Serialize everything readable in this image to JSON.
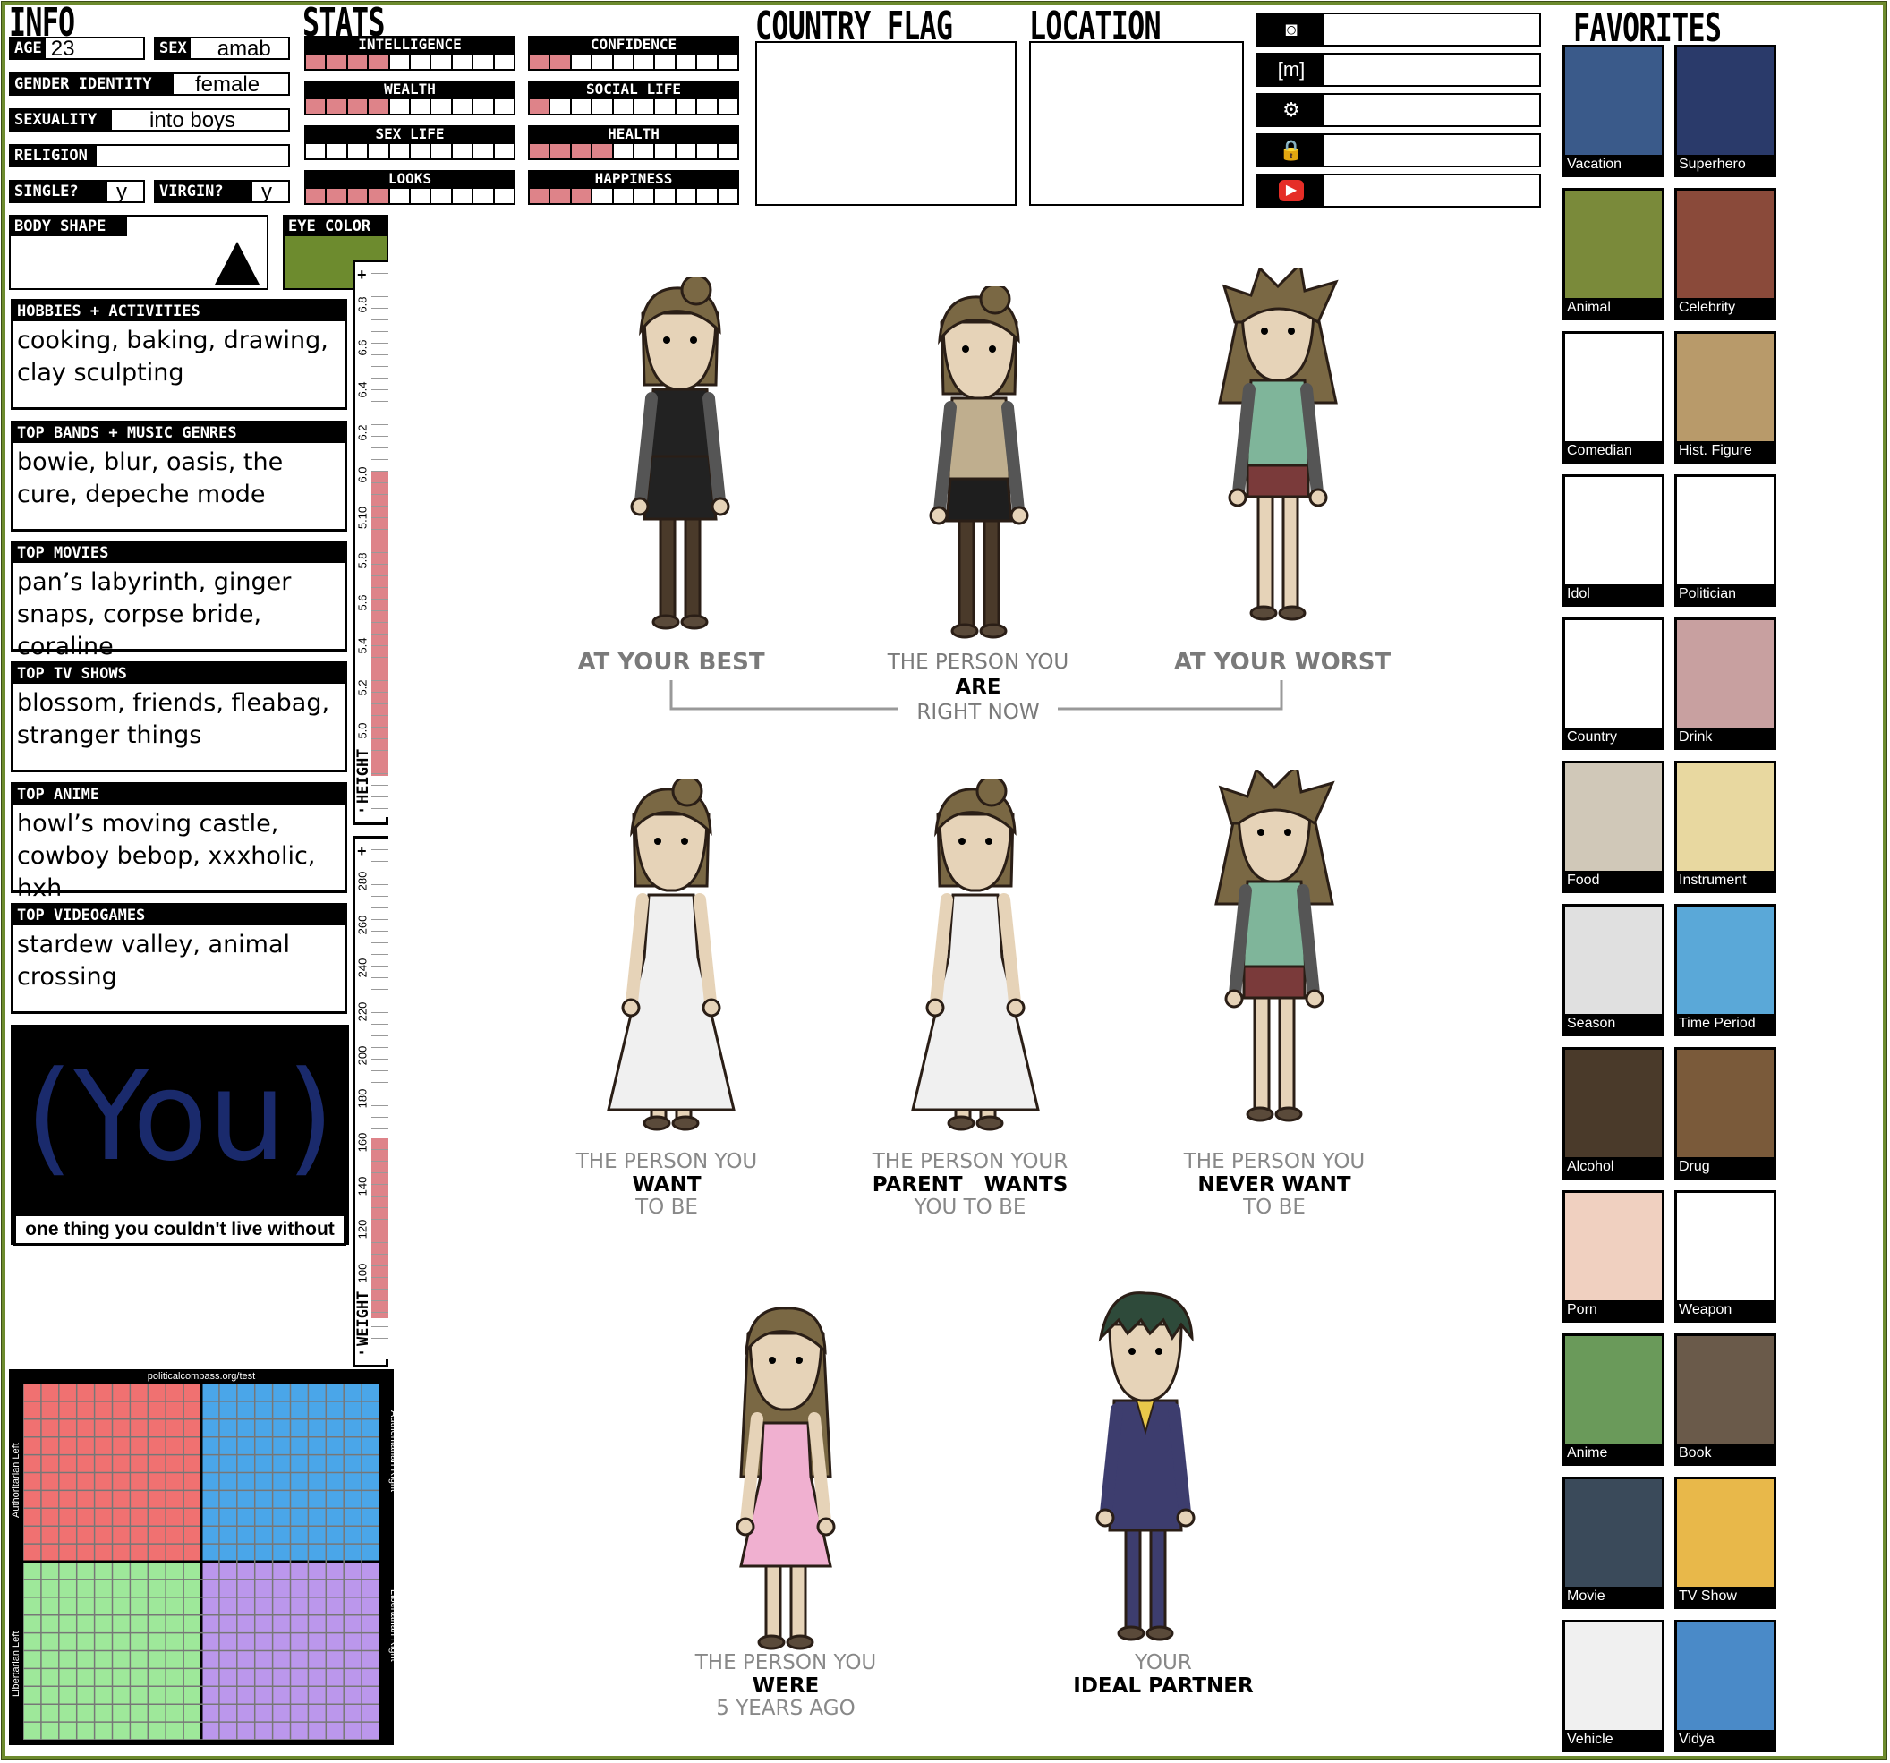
{
  "headers": {
    "info": "INFO",
    "stats": "STATS",
    "country_flag": "COUNTRY FLAG",
    "location": "LOCATION",
    "favorites": "FAVORITES"
  },
  "info": {
    "age_label": "AGE",
    "age": "23",
    "sex_label": "SEX",
    "sex": "amab",
    "gender_label": "GENDER IDENTITY",
    "gender": "female",
    "sexuality_label": "SEXUALITY",
    "sexuality": "into boys",
    "religion_label": "RELIGION",
    "religion": "",
    "single_label": "SINGLE?",
    "single": "y",
    "virgin_label": "VIRGIN?",
    "virgin": "y",
    "body_shape_label": "BODY SHAPE",
    "eye_color_label": "EYE COLOR",
    "eye_color": "#6d8b2e"
  },
  "stats": [
    {
      "label": "INTELLIGENCE",
      "level": 4,
      "max": 10
    },
    {
      "label": "CONFIDENCE",
      "level": 2,
      "max": 10
    },
    {
      "label": "WEALTH",
      "level": 4,
      "max": 10
    },
    {
      "label": "SOCIAL LIFE",
      "level": 1,
      "max": 10
    },
    {
      "label": "SEX LIFE",
      "level": 0,
      "max": 10
    },
    {
      "label": "HEALTH",
      "level": 4,
      "max": 10
    },
    {
      "label": "LOOKS",
      "level": 4,
      "max": 10
    },
    {
      "label": "HAPPINESS",
      "level": 3,
      "max": 10
    }
  ],
  "sections": [
    {
      "title": "HOBBIES + ACTIVITIES",
      "text": "cooking, baking, drawing, clay sculpting"
    },
    {
      "title": "TOP BANDS + MUSIC GENRES",
      "text": "bowie, blur, oasis, the cure, depeche mode"
    },
    {
      "title": "TOP MOVIES",
      "text": "pan’s labyrinth, ginger snaps, corpse bride, coraline"
    },
    {
      "title": "TOP TV SHOWS",
      "text": "blossom, friends, fleabag, stranger things"
    },
    {
      "title": "TOP ANIME",
      "text": "howl’s moving castle, cowboy bebop, xxxholic, hxh"
    },
    {
      "title": "TOP VIDEOGAMES",
      "text": "stardew valley, animal crossing"
    }
  ],
  "you_box": {
    "text": "(You)",
    "caption": "one thing you couldn't live without"
  },
  "height_scale": {
    "label": "HEIGHT",
    "plus": "+",
    "minus": "-",
    "ticks": [
      "6.8",
      "6.6",
      "6.4",
      "6.2",
      "6.0",
      "5.10",
      "5.8",
      "5.6",
      "5.4",
      "5.2",
      "5.0"
    ],
    "fill_fraction": 0.6
  },
  "weight_scale": {
    "label": "WEIGHT",
    "plus": "+",
    "minus": "-",
    "ticks": [
      "280",
      "260",
      "240",
      "220",
      "200",
      "180",
      "160",
      "140",
      "120",
      "100"
    ],
    "fill_fraction": 0.38
  },
  "political_compass": {
    "title": "politicalcompass.org/test",
    "auth_left": "Authoritarian Left",
    "auth_right": "Authoritarian Right",
    "lib_left": "Libertarian Left",
    "lib_right": "Libertarian Right",
    "colors": {
      "auth_left": "#f07171",
      "auth_right": "#4aa6e9",
      "lib_left": "#9ee89a",
      "lib_right": "#bb97ec"
    }
  },
  "social": [
    {
      "icon": "discord-icon",
      "glyph": "◙",
      "value": ""
    },
    {
      "icon": "matrix-icon",
      "glyph": "[m]",
      "value": ""
    },
    {
      "icon": "steam-icon",
      "glyph": "⚙",
      "value": ""
    },
    {
      "icon": "lock-icon",
      "glyph": "🔒",
      "value": ""
    },
    {
      "icon": "youtube-icon",
      "glyph": "▶",
      "value": ""
    }
  ],
  "captions": {
    "best": "AT YOUR BEST",
    "now_1": "THE PERSON YOU",
    "now_2": "ARE",
    "now_3": "RIGHT NOW",
    "worst": "AT YOUR WORST",
    "want_1": "THE PERSON YOU",
    "want_2": "WANT",
    "want_3": "TO BE",
    "parent_1": "THE PERSON YOUR",
    "parent_2": "PARENT   WANTS",
    "parent_3": "YOU TO BE",
    "never_1": "THE PERSON YOU",
    "never_2": "NEVER WANT",
    "never_3": "TO BE",
    "were_1": "THE PERSON YOU",
    "were_2": "WERE",
    "were_3": "5 YEARS AGO",
    "partner_1": "YOUR",
    "partner_2": "IDEAL PARTNER"
  },
  "favorites": [
    {
      "label": "Vacation",
      "color": "#3a5a8a"
    },
    {
      "label": "Superhero",
      "color": "#2a3a6a"
    },
    {
      "label": "Animal",
      "color": "#7a8a3a"
    },
    {
      "label": "Celebrity",
      "color": "#8a4a3a"
    },
    {
      "label": "Comedian",
      "color": ""
    },
    {
      "label": "Hist. Figure",
      "color": "#b89a6a"
    },
    {
      "label": "Idol",
      "color": ""
    },
    {
      "label": "Politician",
      "color": ""
    },
    {
      "label": "Country",
      "color": ""
    },
    {
      "label": "Drink",
      "color": "#c8a0a0"
    },
    {
      "label": "Food",
      "color": "#d0c8b8"
    },
    {
      "label": "Instrument",
      "color": "#e8d8a0"
    },
    {
      "label": "Season",
      "color": "#e0e0e0"
    },
    {
      "label": "Time Period",
      "color": "#5aa8d8"
    },
    {
      "label": "Alcohol",
      "color": "#4a3a2a"
    },
    {
      "label": "Drug",
      "color": "#7a5a3a"
    },
    {
      "label": "Porn",
      "color": "#f0d0c0"
    },
    {
      "label": "Weapon",
      "color": ""
    },
    {
      "label": "Anime",
      "color": "#6a9a5a"
    },
    {
      "label": "Book",
      "color": "#6a5a4a"
    },
    {
      "label": "Movie",
      "color": "#3a4a5a"
    },
    {
      "label": "TV Show",
      "color": "#e8b84a"
    },
    {
      "label": "Vehicle",
      "color": "#f0f0f0"
    },
    {
      "label": "Vidya",
      "color": "#4a8ac8"
    }
  ]
}
